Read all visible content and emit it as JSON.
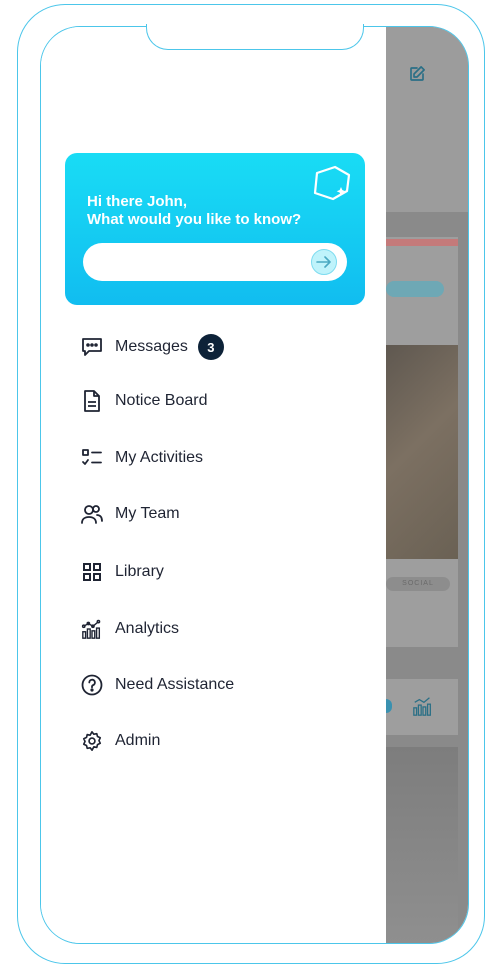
{
  "assistant_card": {
    "greeting": "Hi there John,",
    "prompt": "What would you like to know?",
    "input_value": "",
    "input_placeholder": ""
  },
  "menu": {
    "items": [
      {
        "label": "Messages",
        "icon": "message-icon",
        "badge": "3"
      },
      {
        "label": "Notice Board",
        "icon": "document-icon"
      },
      {
        "label": "My Activities",
        "icon": "checklist-icon"
      },
      {
        "label": "My Team",
        "icon": "team-icon"
      },
      {
        "label": "Library",
        "icon": "grid-icon"
      },
      {
        "label": "Analytics",
        "icon": "analytics-icon"
      },
      {
        "label": "Need Assistance",
        "icon": "help-icon"
      },
      {
        "label": "Admin",
        "icon": "gear-icon"
      }
    ]
  },
  "background": {
    "social_tag": "SOCIAL"
  },
  "colors": {
    "accent": "#19dcf5",
    "frame": "#4cc6ea",
    "text": "#1f2433",
    "badge": "#0d2238"
  }
}
